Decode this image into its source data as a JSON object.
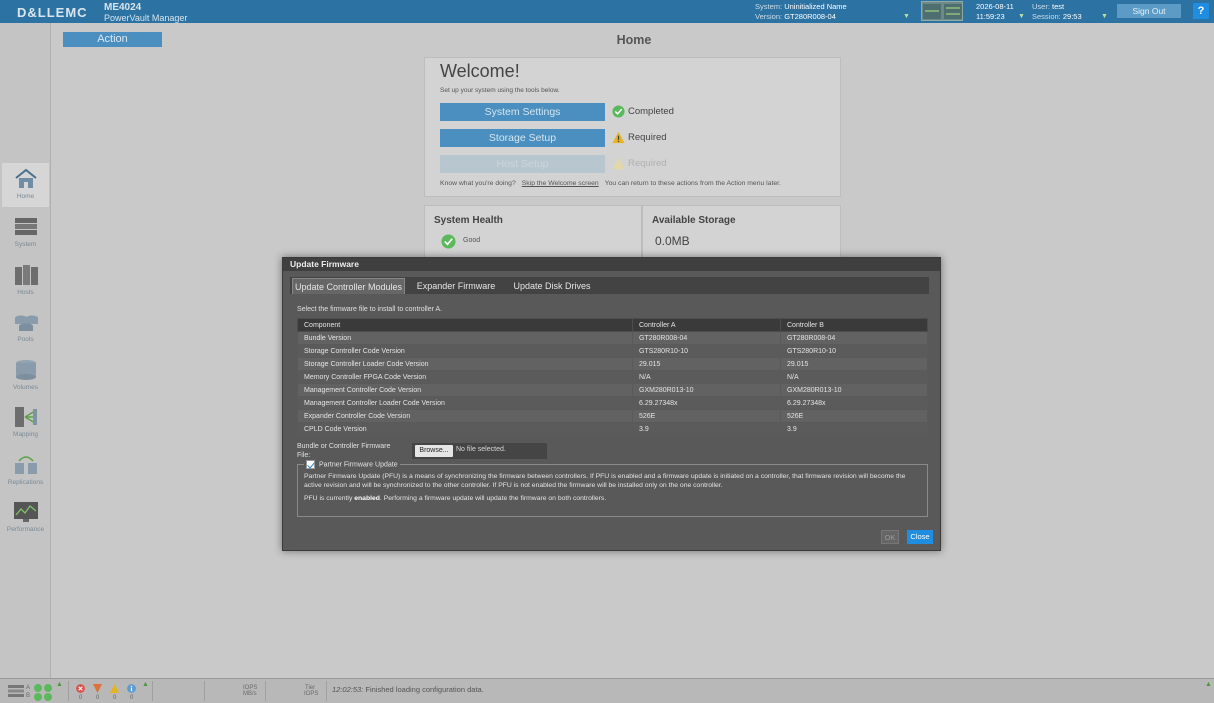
{
  "header": {
    "logo": "D&LLEMC",
    "product_model": "ME4024",
    "product_name": "PowerVault Manager",
    "system_label": "System:",
    "system_value": "Uninitialized Name",
    "version_label": "Version:",
    "version_value": "GT280R008-04",
    "date": "2026-08-11",
    "time": "11:59:23",
    "user_label": "User:",
    "user_value": "test",
    "session_label": "Session:",
    "session_value": "29:53",
    "signout_label": "Sign Out",
    "help_label": "?"
  },
  "sidebar": {
    "items": [
      {
        "label": "Home",
        "icon": "home-icon"
      },
      {
        "label": "System",
        "icon": "system-icon"
      },
      {
        "label": "Hosts",
        "icon": "hosts-icon"
      },
      {
        "label": "Pools",
        "icon": "pools-icon"
      },
      {
        "label": "Volumes",
        "icon": "volumes-icon"
      },
      {
        "label": "Mapping",
        "icon": "mapping-icon"
      },
      {
        "label": "Replications",
        "icon": "replications-icon"
      },
      {
        "label": "Performance",
        "icon": "performance-icon"
      }
    ]
  },
  "main": {
    "action_label": "Action",
    "page_title": "Home",
    "welcome": {
      "title": "Welcome!",
      "subtitle": "Set up your system using the tools below.",
      "steps": [
        {
          "label": "System Settings",
          "status": "Completed"
        },
        {
          "label": "Storage Setup",
          "status": "Required"
        },
        {
          "label": "Host Setup",
          "status": "Required"
        }
      ],
      "footer_prefix": "Know what you're doing?",
      "footer_link": "Skip the Welcome screen",
      "footer_suffix": "You can return to these actions from the Action menu later."
    },
    "health": {
      "title": "System Health",
      "status": "Good"
    },
    "storage": {
      "title": "Available Storage",
      "value": "0.0MB"
    }
  },
  "dialog": {
    "title": "Update Firmware",
    "tabs": [
      "Update Controller Modules",
      "Expander Firmware",
      "Update Disk Drives"
    ],
    "instruction": "Select the firmware file to install to controller A.",
    "table": {
      "headers": [
        "Component",
        "Controller A",
        "Controller B"
      ],
      "rows": [
        [
          "Bundle Version",
          "GT280R008-04",
          "GT280R008-04"
        ],
        [
          "Storage Controller Code Version",
          "GTS280R10-10",
          "GTS280R10-10"
        ],
        [
          "Storage Controller Loader Code Version",
          "29.015",
          "29.015"
        ],
        [
          "Memory Controller FPGA Code Version",
          "N/A",
          "N/A"
        ],
        [
          "Management Controller Code Version",
          "GXM280R013-10",
          "GXM280R013-10"
        ],
        [
          "Management Controller Loader Code Version",
          "6.29.27348x",
          "6.29.27348x"
        ],
        [
          "Expander Controller Code Version",
          "526E",
          "526E"
        ],
        [
          "CPLD Code Version",
          "3.9",
          "3.9"
        ]
      ]
    },
    "file_label": "Bundle or Controller Firmware File:",
    "browse_label": "Browse...",
    "no_file": "No file selected.",
    "pfu": {
      "legend": "Partner Firmware Update",
      "checked": true,
      "description": "Partner Firmware Update (PFU) is a means of synchronizing the firmware between controllers. If PFU is enabled and a firmware update is initiated on a controller, that firmware revision will become the active revision and will be synchronized to the other controller. If PFU is not enabled the firmware will be installed only on the one controller.",
      "status_prefix": "PFU is currently",
      "status_value": "enabled",
      "status_suffix": ". Performing a firmware update will update the firmware on both controllers."
    },
    "ok_label": "OK",
    "close_label": "Close"
  },
  "footer": {
    "controller_a": "A",
    "controller_b": "B",
    "alert_counts": [
      "0",
      "0",
      "0",
      "0"
    ],
    "iops_label_1": "IOPS",
    "mbs_label": "MB/s",
    "tier_label": "Tier",
    "iops_label_2": "IOPS",
    "message_time": "12:02:53:",
    "message_text": "Finished loading configuration data."
  },
  "colors": {
    "header_bg": "#2c73a3",
    "accent": "#4a8fbf",
    "dialog_bg": "#595959",
    "close_button": "#1f8de0",
    "ok_green": "#5cb85c",
    "warning_yellow": "#e8b320",
    "error_red": "#d9534f"
  }
}
